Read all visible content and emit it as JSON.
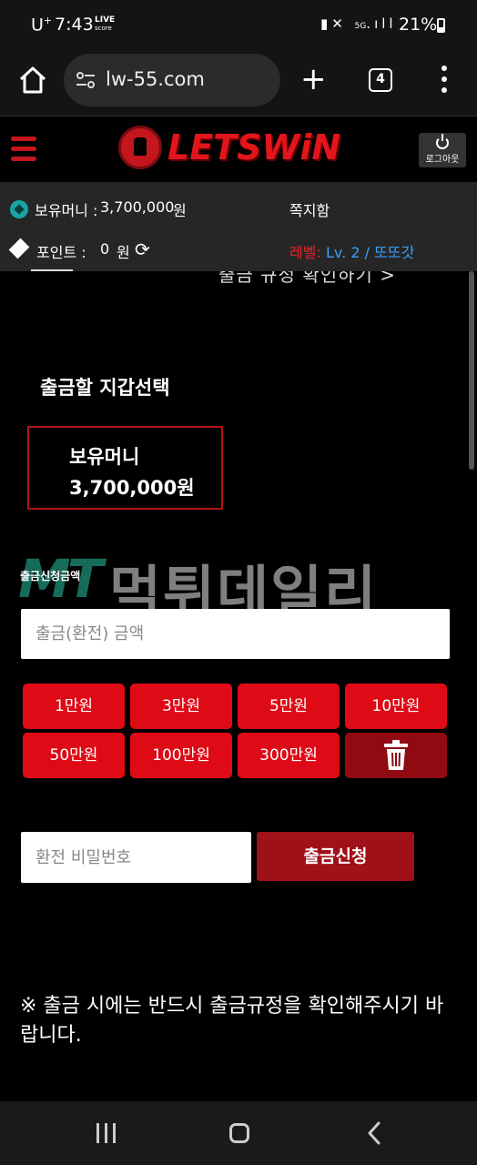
{
  "status_bar": {
    "carrier": "U",
    "carrier_sup": "+",
    "time": "7:43",
    "live_top": "LIVE",
    "live_bottom": "score",
    "network": "5G",
    "battery": "21%"
  },
  "browser": {
    "url": "lw-55.com",
    "tab_count": "4"
  },
  "header": {
    "logo_text": "LETSWiN",
    "logout_label": "로그아웃"
  },
  "info": {
    "money_label": "보유머니 :",
    "money_value": "3,700,000",
    "money_unit": "원",
    "messages": "쪽지함",
    "point_label": "포인트 :",
    "point_value": "0",
    "point_unit": "원",
    "level_label": "레벨:",
    "level_value": "Lv. 2 / 또또갓"
  },
  "main": {
    "partial_link": "출금 규정 확인하기 >",
    "wallet_title": "출금할 지갑선택",
    "wallet_name": "보유머니",
    "wallet_amount": "3,700,000원",
    "watermark_logo": "MT",
    "watermark_text": "먹튀데일리",
    "amount_label": "출금신청금액",
    "amount_placeholder": "출금(환전) 금액",
    "quick_amounts": [
      "1만원",
      "3만원",
      "5만원",
      "10만원",
      "50만원",
      "100만원",
      "300만원"
    ],
    "password_placeholder": "환전 비밀번호",
    "submit_label": "출금신청",
    "notice": "※ 출금 시에는 반드시 출금규정을 확인해주시기 바랍니다."
  },
  "colors": {
    "brand_red": "#de0a16",
    "dark_red": "#a01018",
    "level_blue": "#3aa0ff"
  },
  "icons": [
    "home-icon",
    "site-settings-icon",
    "plus-icon",
    "tabs-icon",
    "more-icon",
    "menu-icon",
    "power-icon",
    "soccer-ball-icon",
    "diamond-icon",
    "refresh-icon",
    "trash-icon",
    "recent-apps-icon",
    "nav-home-icon",
    "back-icon"
  ]
}
